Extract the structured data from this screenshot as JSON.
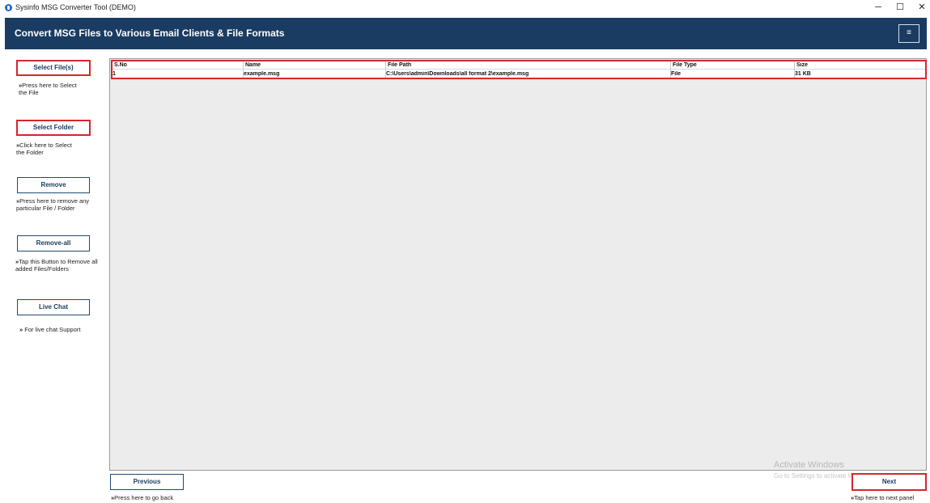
{
  "window": {
    "title": "Sysinfo MSG Converter Tool (DEMO)",
    "controls": {
      "minimize": "─",
      "maximize": "☐",
      "close": "✕"
    }
  },
  "header": {
    "title": "Convert MSG Files to Various Email Clients & File Formats",
    "menu_icon": "≡"
  },
  "sidebar": {
    "select_files": {
      "label": "Select File(s)",
      "hint_line1": "Press here to Select",
      "hint_line2": "the File"
    },
    "select_folder": {
      "label": "Select Folder",
      "hint_line1": "Click here to Select",
      "hint_line2": "the Folder"
    },
    "remove": {
      "label": "Remove",
      "hint_line1": "Press here to remove any",
      "hint_line2": "particular File / Folder"
    },
    "remove_all": {
      "label": "Remove-all",
      "hint_line1": "Tap this Button to Remove all",
      "hint_line2": "added Files/Folders"
    },
    "live_chat": {
      "label": "Live Chat",
      "hint_line1": " For live chat Support"
    }
  },
  "table": {
    "columns": [
      "S.No",
      "Name",
      "File Path",
      "File Type",
      "Size"
    ],
    "rows": [
      [
        "1",
        "example.msg",
        "C:\\Users\\admin\\Downloads\\all format 2\\example.msg",
        "File",
        "31 KB"
      ]
    ]
  },
  "footer": {
    "previous": {
      "label": "Previous",
      "hint": "Press here to go back"
    },
    "next": {
      "label": "Next",
      "hint": "Tap here to next panel"
    }
  },
  "watermark": {
    "line1": "Activate Windows",
    "line2": "Go to Settings to activate Windows."
  },
  "colors": {
    "header_bg": "#1a3c62",
    "highlight": "#d6262b",
    "button_border": "#1e4a73"
  }
}
